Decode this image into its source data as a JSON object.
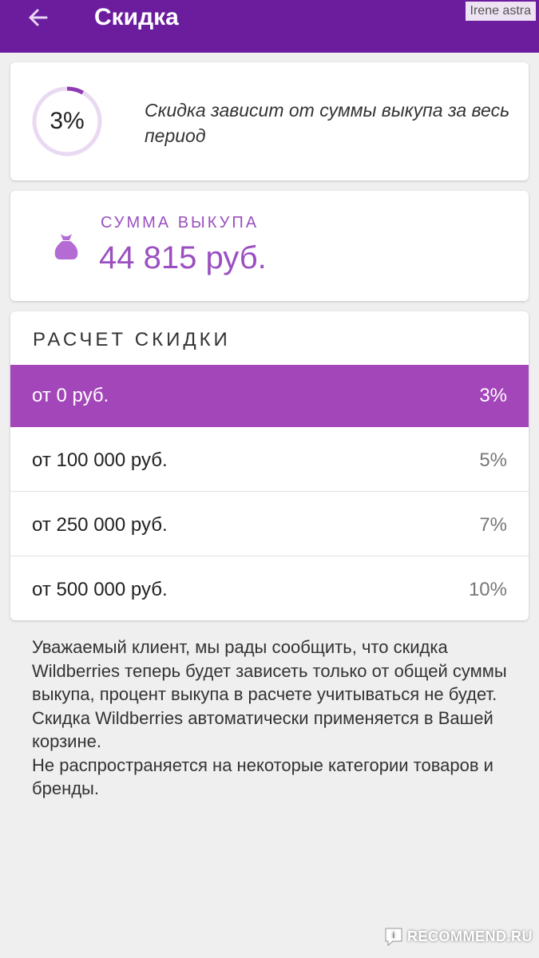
{
  "appbar": {
    "title": "Скидка",
    "back_icon": "arrow-left-icon",
    "color": "#6b1d9e"
  },
  "watermark_top": "Irene astra",
  "discount_card": {
    "percent_label": "3%",
    "ring_progress": 0.08,
    "note": "Скидка зависит от суммы выкупа за весь период"
  },
  "sum_card": {
    "icon": "money-bag-icon",
    "label": "СУММА ВЫКУПА",
    "value": "44 815 руб.",
    "accent": "#9b4fc0"
  },
  "calc_card": {
    "title": "РАСЧЕТ СКИДКИ",
    "tiers": [
      {
        "label": "от 0 руб.",
        "percent": "3%",
        "active": true
      },
      {
        "label": "от 100 000 руб.",
        "percent": "5%",
        "active": false
      },
      {
        "label": "от 250 000 руб.",
        "percent": "7%",
        "active": false
      },
      {
        "label": "от 500 000 руб.",
        "percent": "10%",
        "active": false
      }
    ],
    "active_color": "#a346b9"
  },
  "info": {
    "paragraphs": [
      "Уважаемый клиент, мы рады сообщить, что скидка Wildberries теперь будет зависеть только от общей суммы выкупа, процент выкупа в расчете учитываться не будет.",
      "Скидка Wildberries автоматически применяется в Вашей корзине.",
      "Не распространяется на некоторые категории товаров и бренды."
    ]
  },
  "watermark_bottom": "RECOMMEND.RU"
}
